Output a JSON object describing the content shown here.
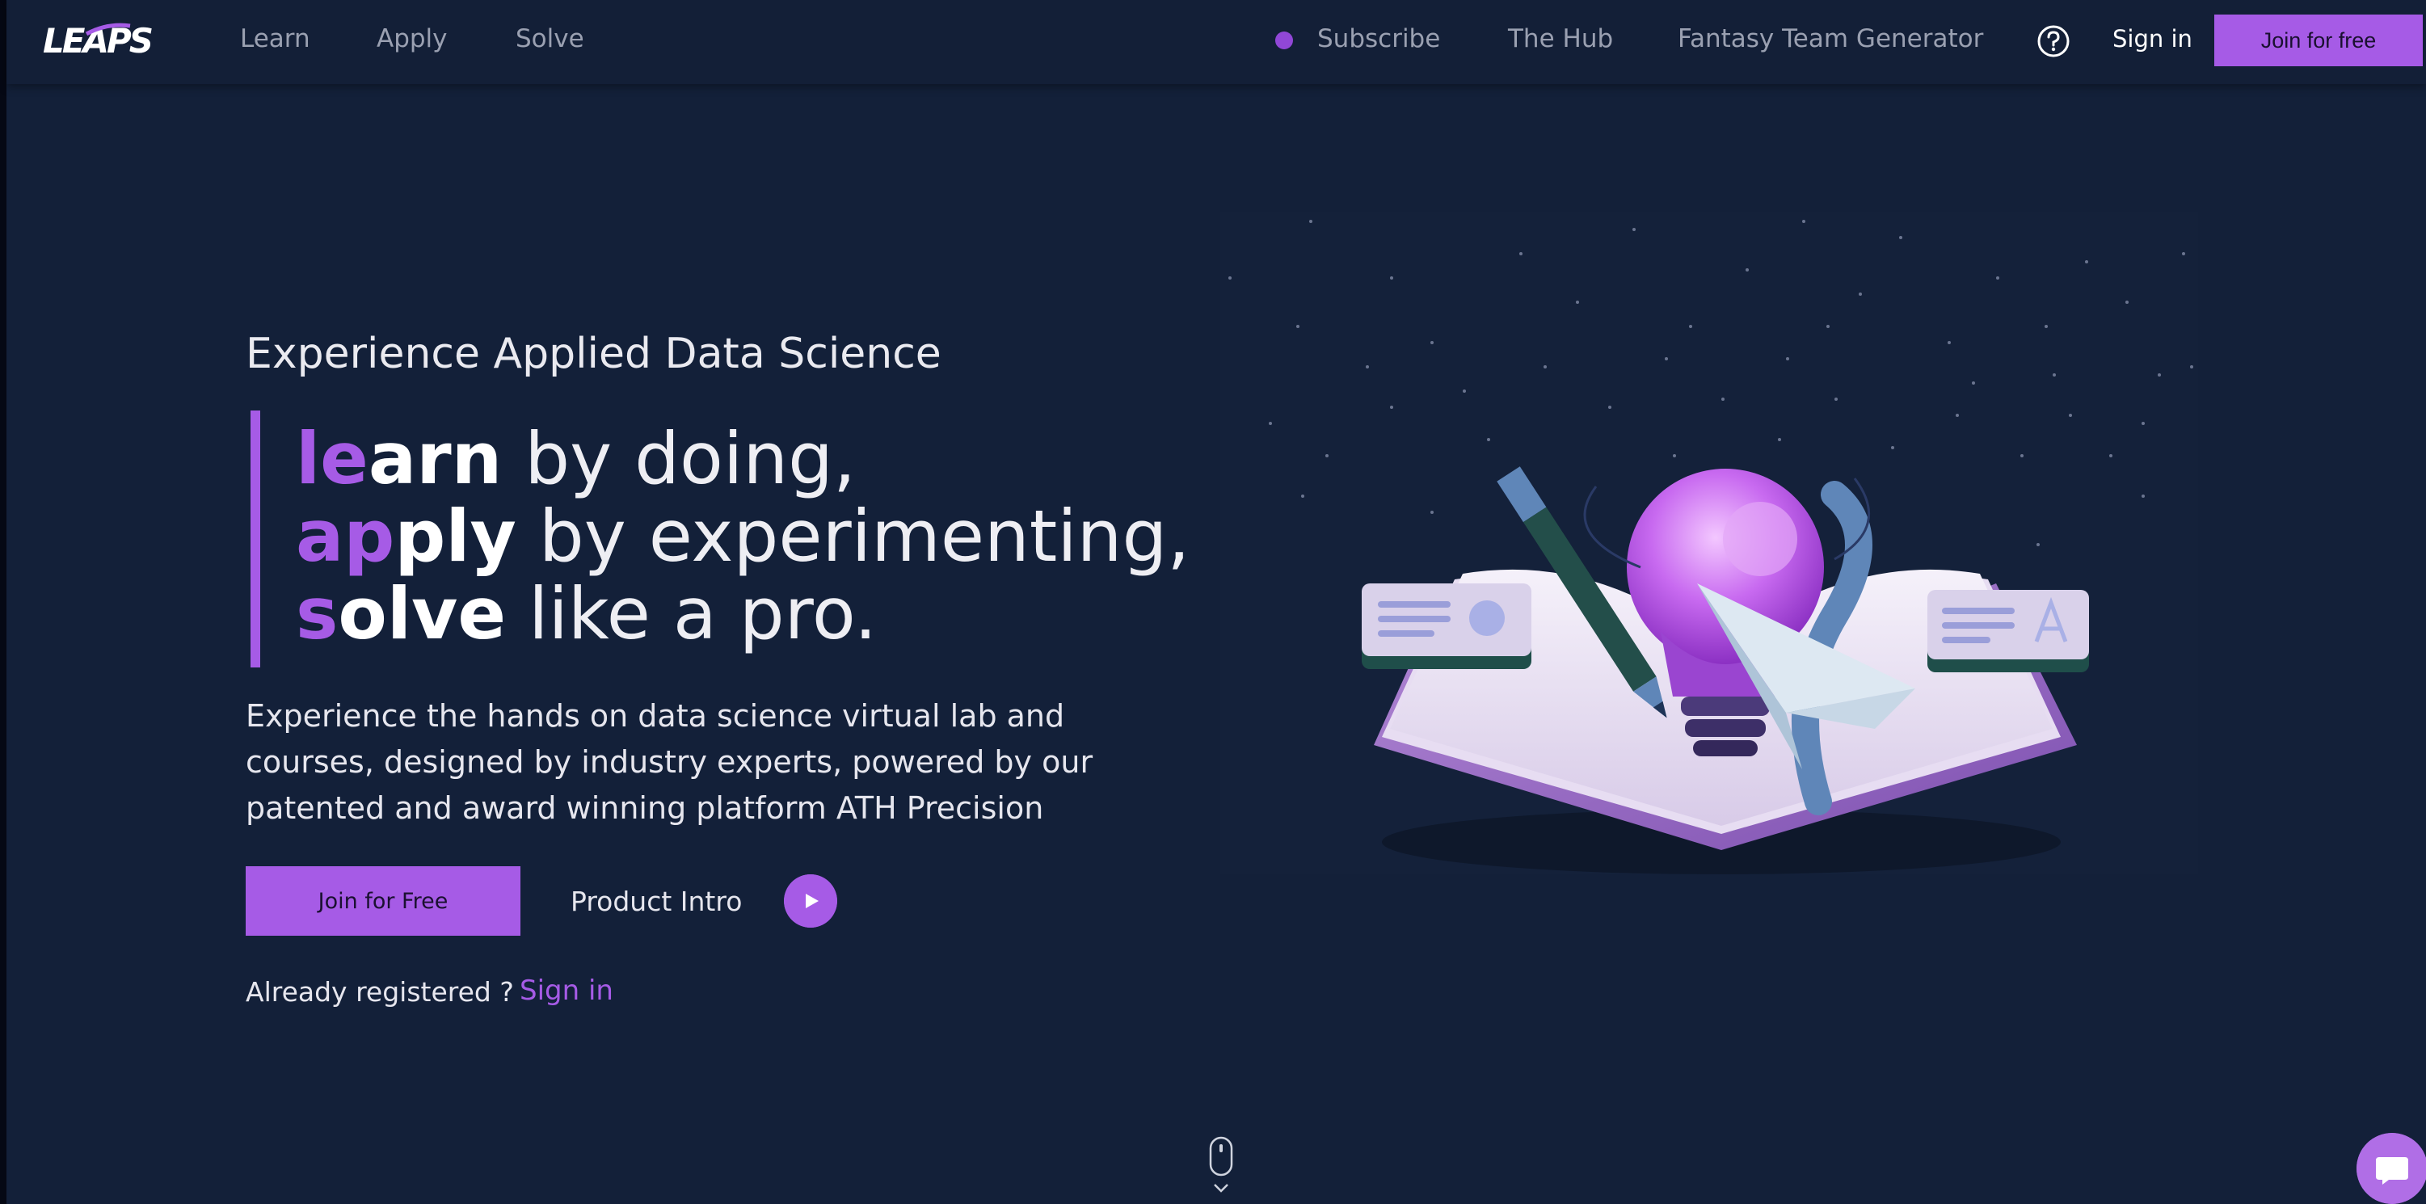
{
  "nav": {
    "logo": "LEAPS",
    "links": [
      "Learn",
      "Apply",
      "Solve"
    ],
    "right_links": [
      "Subscribe",
      "The Hub",
      "Fantasy Team Generator"
    ],
    "sign_in": "Sign in",
    "join": "Join for free"
  },
  "hero": {
    "kicker": "Experience Applied Data Science",
    "lines": [
      {
        "accent": "le",
        "strong": "arn",
        "rest": " by doing,"
      },
      {
        "accent": "ap",
        "strong": "ply",
        "rest": " by experimenting,"
      },
      {
        "accent": "s",
        "strong": "olve",
        "rest": " like a pro."
      }
    ],
    "lead": "Experience the hands on data science virtual lab and courses, designed by industry experts, powered by our patented and award winning platform ATH Precision",
    "cta": "Join for Free",
    "intro": "Product Intro",
    "registered": "Already registered ?",
    "registered_link": "Sign in"
  },
  "colors": {
    "background": "#132039",
    "accent": "#a65be6",
    "text": "#e8e8ef"
  },
  "icons": [
    "help-icon",
    "play-icon",
    "scroll-mouse-icon",
    "chevron-down-icon",
    "chat-icon"
  ]
}
